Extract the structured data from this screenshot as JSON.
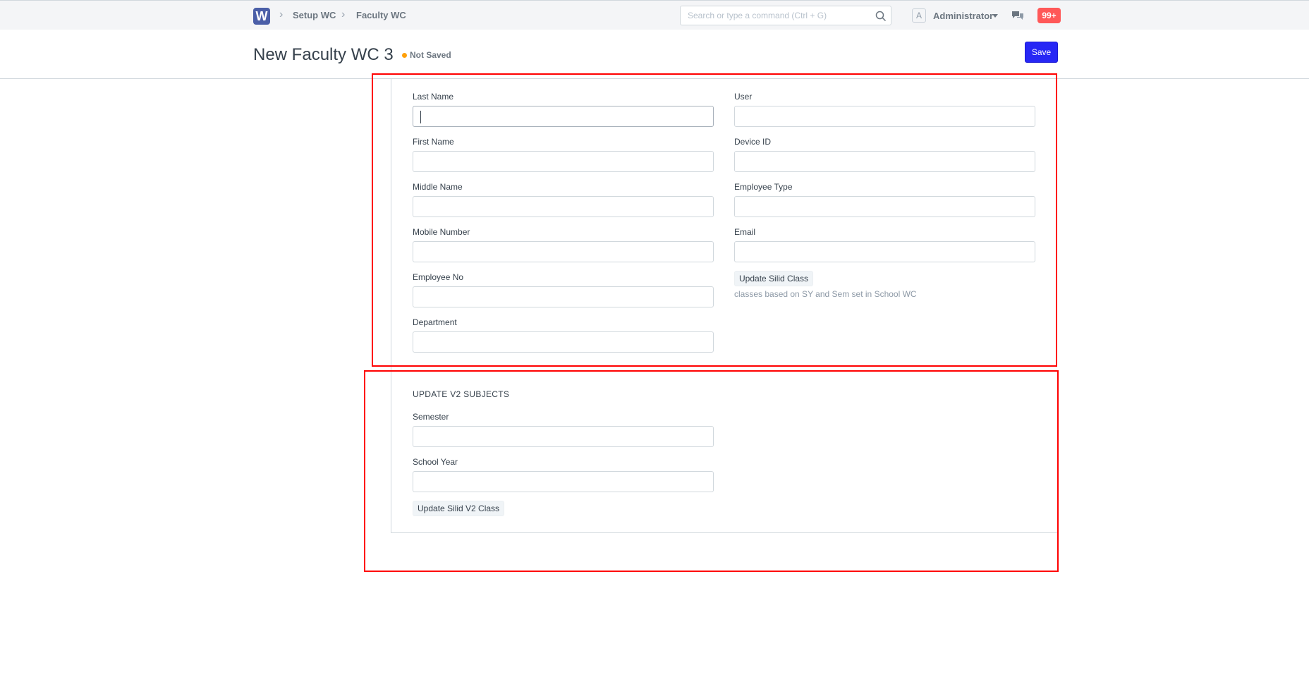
{
  "navbar": {
    "logo_letter": "W",
    "breadcrumbs": [
      "Setup WC",
      "Faculty WC"
    ],
    "search_placeholder": "Search or type a command (Ctrl + G)",
    "user_initial": "A",
    "user_name": "Administrator",
    "notification_count": "99+"
  },
  "page": {
    "title": "New Faculty WC 3",
    "status": "Not Saved",
    "save_label": "Save"
  },
  "form": {
    "left_fields": [
      {
        "label": "Last Name",
        "value": ""
      },
      {
        "label": "First Name",
        "value": ""
      },
      {
        "label": "Middle Name",
        "value": ""
      },
      {
        "label": "Mobile Number",
        "value": ""
      },
      {
        "label": "Employee No",
        "value": ""
      },
      {
        "label": "Department",
        "value": ""
      }
    ],
    "right_fields": [
      {
        "label": "User",
        "value": ""
      },
      {
        "label": "Device ID",
        "value": ""
      },
      {
        "label": "Employee Type",
        "value": ""
      },
      {
        "label": "Email",
        "value": ""
      }
    ],
    "update_class_button": "Update Silid Class",
    "update_class_help": "classes based on SY and Sem set in School WC",
    "section2": {
      "heading": "UPDATE V2 SUBJECTS",
      "fields": [
        {
          "label": "Semester",
          "value": ""
        },
        {
          "label": "School Year",
          "value": ""
        }
      ],
      "button": "Update Silid V2 Class"
    }
  },
  "colors": {
    "accent": "#2727f5",
    "annotation": "#ff0000",
    "not_saved_dot": "#ffa00a",
    "badge": "#ff5858"
  }
}
